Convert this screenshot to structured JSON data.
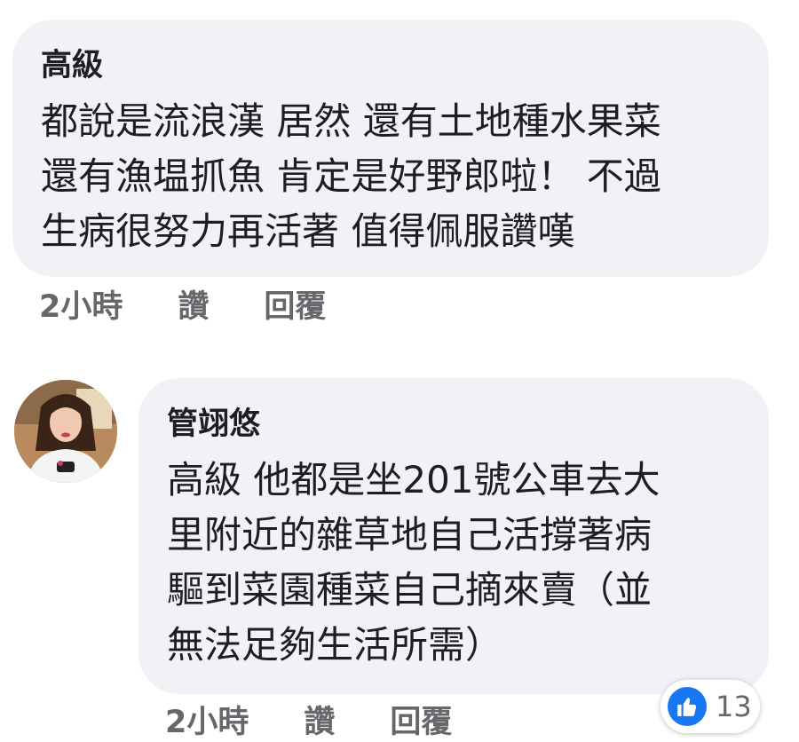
{
  "colors": {
    "bubble_background": "#f0f2f5",
    "meta_text": "#65676b",
    "like_blue": "#1877f2"
  },
  "comments": [
    {
      "author": "高級",
      "lines": [
        "都說是流浪漢 居然 還有土地種水果菜",
        "還有漁塭抓魚 肯定是好野郎啦！ 不過",
        "生病很努力再活著 值得佩服讚嘆"
      ],
      "time": "2小時",
      "like_label": "讚",
      "reply_label": "回覆"
    },
    {
      "author": "管翊悠",
      "avatar_icon": "profile-photo",
      "lines": [
        "高級 他都是坐201號公車去大",
        "里附近的雜草地自己活撐著病",
        "驅到菜園種菜自己摘來賣（並",
        "無法足夠生活所需）"
      ],
      "time": "2小時",
      "like_label": "讚",
      "reply_label": "回覆",
      "reaction": {
        "icon": "thumbs-up-icon",
        "count": "13"
      }
    }
  ]
}
